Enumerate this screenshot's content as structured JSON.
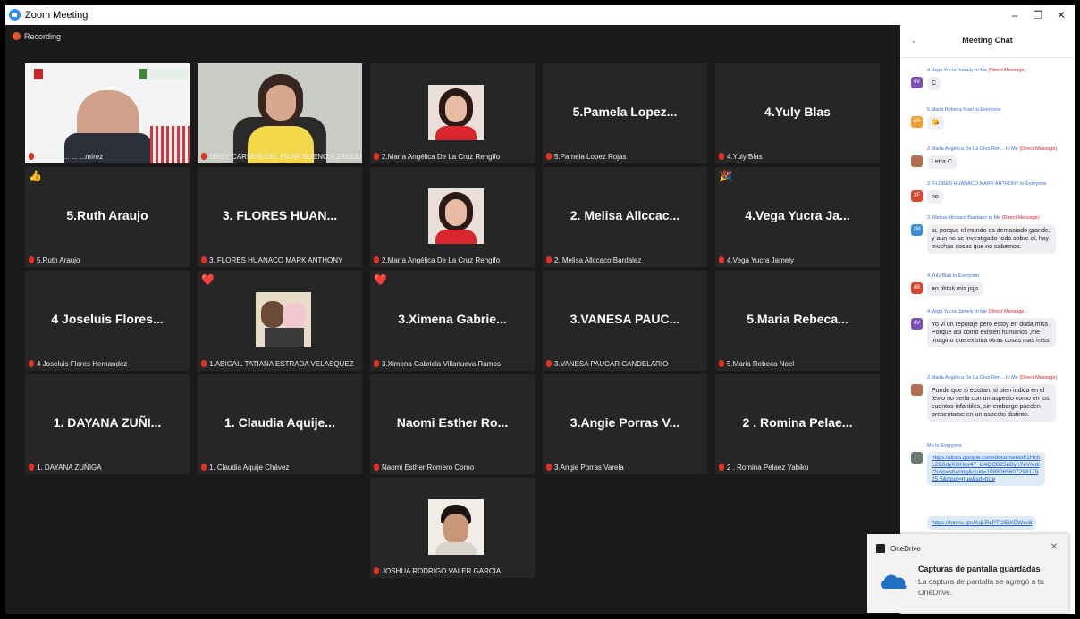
{
  "window": {
    "title": "Zoom Meeting",
    "minimize": "–",
    "restore": "❐",
    "close": "✕"
  },
  "recording": "Recording",
  "tiles": [
    {
      "big": "",
      "name": "Ricardo ... ... ...mírez",
      "emoji": ""
    },
    {
      "big": "",
      "name": "MARY CARMEN DEL PILAR BUENO A ZAMUDIO",
      "emoji": ""
    },
    {
      "big": "",
      "name": "2.María Angélica De La Cruz Rengifo",
      "emoji": ""
    },
    {
      "big": "5.Pamela Lopez...",
      "name": "5.Pamela Lopez Rojas",
      "emoji": ""
    },
    {
      "big": "4.Yuly Blas",
      "name": "4.Yuly Blas",
      "emoji": ""
    },
    {
      "big": "5.Ruth Araujo",
      "name": "5.Ruth Araujo",
      "emoji": "👍"
    },
    {
      "big": "3. FLORES HUAN...",
      "name": "3. FLORES HUANACO MARK ANTHONY",
      "emoji": ""
    },
    {
      "big": "",
      "name": "2.María Angélica De La Cruz Rengifo",
      "emoji": ""
    },
    {
      "big": "2. Melisa Allccac...",
      "name": "2. Melisa Allccaco Bardalez",
      "emoji": ""
    },
    {
      "big": "4.Vega Yucra Ja...",
      "name": "4.Vega Yucra Jamely",
      "emoji": "🎉"
    },
    {
      "big": "4 Joseluis Flores...",
      "name": "4 Joseluis Flores Hernandez",
      "emoji": ""
    },
    {
      "big": "",
      "name": "1.ABIGAIL TATIANA ESTRADA VELASQUEZ",
      "emoji": "❤️"
    },
    {
      "big": "3.Ximena Gabrie...",
      "name": "3.Ximena Gabriela Villanueva Ramos",
      "emoji": "❤️"
    },
    {
      "big": "3.VANESA PAUC...",
      "name": "3.VANESA PAUCAR CANDELARIO",
      "emoji": ""
    },
    {
      "big": "5.Maria Rebeca...",
      "name": "5.Maria Rebeca Noel",
      "emoji": ""
    },
    {
      "big": "1. DAYANA ZUÑI...",
      "name": "1. DAYANA ZUÑIGA",
      "emoji": ""
    },
    {
      "big": "1. Claudia Aquije...",
      "name": "1. Claudia Aquije Chávez",
      "emoji": ""
    },
    {
      "big": "Naomi Esther Ro...",
      "name": "Naomi Esther Romero Corno",
      "emoji": ""
    },
    {
      "big": "3.Angie Porras V...",
      "name": "3.Angie Porras Varela",
      "emoji": ""
    },
    {
      "big": "2 . Romina Pelae...",
      "name": "2 . Romina Pelaez Yabiku",
      "emoji": ""
    },
    {
      "big": "",
      "name": "JOSHUA RODRIGO VALER GARCIA",
      "emoji": ""
    }
  ],
  "chat": {
    "title": "Meeting Chat",
    "messages": [
      {
        "from": "4.Vega Yucra Jamely",
        "to": "to Me",
        "tag": "(Direct Message)",
        "avatar": "4V",
        "avatar_color": "#7c4fb5",
        "text": "C"
      },
      {
        "from": "5.Maria Rebeca Noel",
        "to": "to Everyone",
        "tag": "",
        "avatar": "5R",
        "avatar_color": "#f0a030",
        "text": "😘"
      },
      {
        "from": "2.María Angélica De La Cruz Ren...",
        "to": "to Me",
        "tag": "(Direct Message)",
        "avatar": "",
        "avatar_color": "#b07050",
        "text": "Letra C"
      },
      {
        "from": "3. FLORES HUANACO MARK ANTHONY",
        "to": "to Everyone",
        "tag": "",
        "avatar": "3F",
        "avatar_color": "#d9462e",
        "text": "no"
      },
      {
        "from": "2. Melisa Allccaco Bardalez",
        "to": "to Me",
        "tag": "(Direct Message)",
        "avatar": "2M",
        "avatar_color": "#3a8fd8",
        "text": "si, porque el mundo es demasiado grande, y aun no se investigado todo sobre el, hay muchas cosas que no sabemos."
      },
      {
        "from": "4.Yuly Blas",
        "to": "to Everyone",
        "tag": "",
        "avatar": "4B",
        "avatar_color": "#d9462e",
        "text": "en tiktok mis jsjjs"
      },
      {
        "from": "4.Vega Yucra Jamely",
        "to": "to Me",
        "tag": "(Direct Message)",
        "avatar": "4V",
        "avatar_color": "#7c4fb5",
        "text": "Yo vi un repotaje pero estoy en duda miss Porque asi como existen humanos ,me imagino que existira otras cosas mas miss"
      },
      {
        "from": "2.María Angélica De La Cruz Ren...",
        "to": "to Me",
        "tag": "(Direct Message)",
        "avatar": "",
        "avatar_color": "#b07050",
        "text": "Puede que si existan, si bien indica en el texto no sería con un aspecto como en los cuentos infantiles, sin embargo pueden presentarse en un aspecto distinto."
      },
      {
        "from": "Me",
        "to": "to Everyone",
        "tag": "",
        "avatar": "",
        "avatar_color": "#6a7a6a",
        "text": "https://docs.google.com/document/d/1HchL2C6dyKUHqv47_lc4QCB25eDyn7eV/edit?usp=sharing&ouid=108806560729817925 5&rtpof=true&sd=true",
        "text2": "https://forms.gle/KqLRcPTt2EiXDWxc8"
      }
    ]
  },
  "toast": {
    "app": "OneDrive",
    "heading": "Capturas de pantalla guardadas",
    "body": "La captura de pantalla se agregó a tu OneDrive.",
    "close": "✕"
  }
}
